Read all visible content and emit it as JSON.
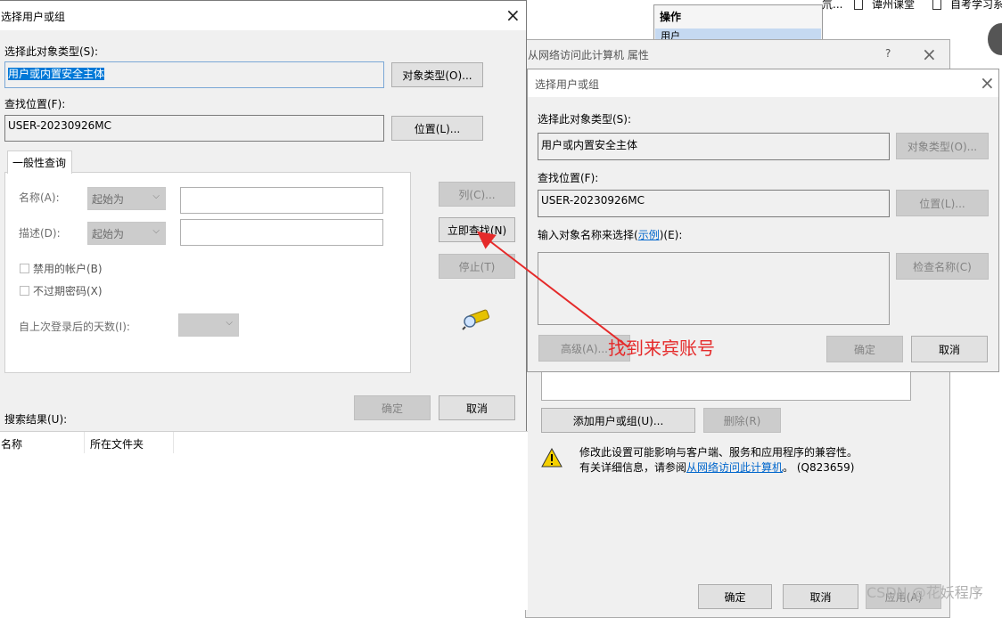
{
  "bg_top": {
    "ops_header": "操作",
    "ops_item": "用户",
    "top_right_1": "谭州课堂",
    "top_right_2": "自考学习系",
    "top_cut": "氘..."
  },
  "property_window": {
    "title": "从网络访问此计算机 属性",
    "help": "?",
    "add_button": "添加用户或组(U)...",
    "delete_button": "删除(R)",
    "warning_line1": "修改此设置可能影响与客户端、服务和应用程序的兼容性。",
    "warning_line2_prefix": "有关详细信息，请参阅",
    "warning_link": "从网络访问此计算机",
    "warning_line2_suffix": "。 (Q823659)",
    "ok": "确定",
    "cancel": "取消",
    "apply": "应用(A)"
  },
  "left_dialog": {
    "title": "选择用户或组",
    "object_type_label": "选择此对象类型(S):",
    "object_type_value": "用户或内置安全主体",
    "object_type_button": "对象类型(O)...",
    "location_label": "查找位置(F):",
    "location_value": "USER-20230926MC",
    "location_button": "位置(L)...",
    "tab_general": "一般性查询",
    "name_label": "名称(A):",
    "desc_label": "描述(D):",
    "starts_with": "起始为",
    "disabled_accounts": "禁用的帐户(B)",
    "no_expire_pw": "不过期密码(X)",
    "days_since_login": "自上次登录后的天数(I):",
    "columns_button": "列(C)...",
    "find_now_button": "立即查找(N)",
    "stop_button": "停止(T)",
    "ok": "确定",
    "cancel": "取消",
    "results_label": "搜索结果(U):",
    "col_name": "名称",
    "col_folder": "所在文件夹"
  },
  "right_dialog": {
    "title": "选择用户或组",
    "object_type_label": "选择此对象类型(S):",
    "object_type_value": "用户或内置安全主体",
    "object_type_button": "对象类型(O)...",
    "location_label": "查找位置(F):",
    "location_value": "USER-20230926MC",
    "location_button": "位置(L)...",
    "enter_label_prefix": "输入对象名称来选择(",
    "enter_label_link": "示例",
    "enter_label_suffix": ")(E):",
    "check_names_button": "检查名称(C)",
    "advanced_button": "高级(A)...",
    "ok": "确定",
    "cancel": "取消"
  },
  "annotation": {
    "text": "找到来宾账号"
  },
  "watermark": "CSDN @花妖程序"
}
